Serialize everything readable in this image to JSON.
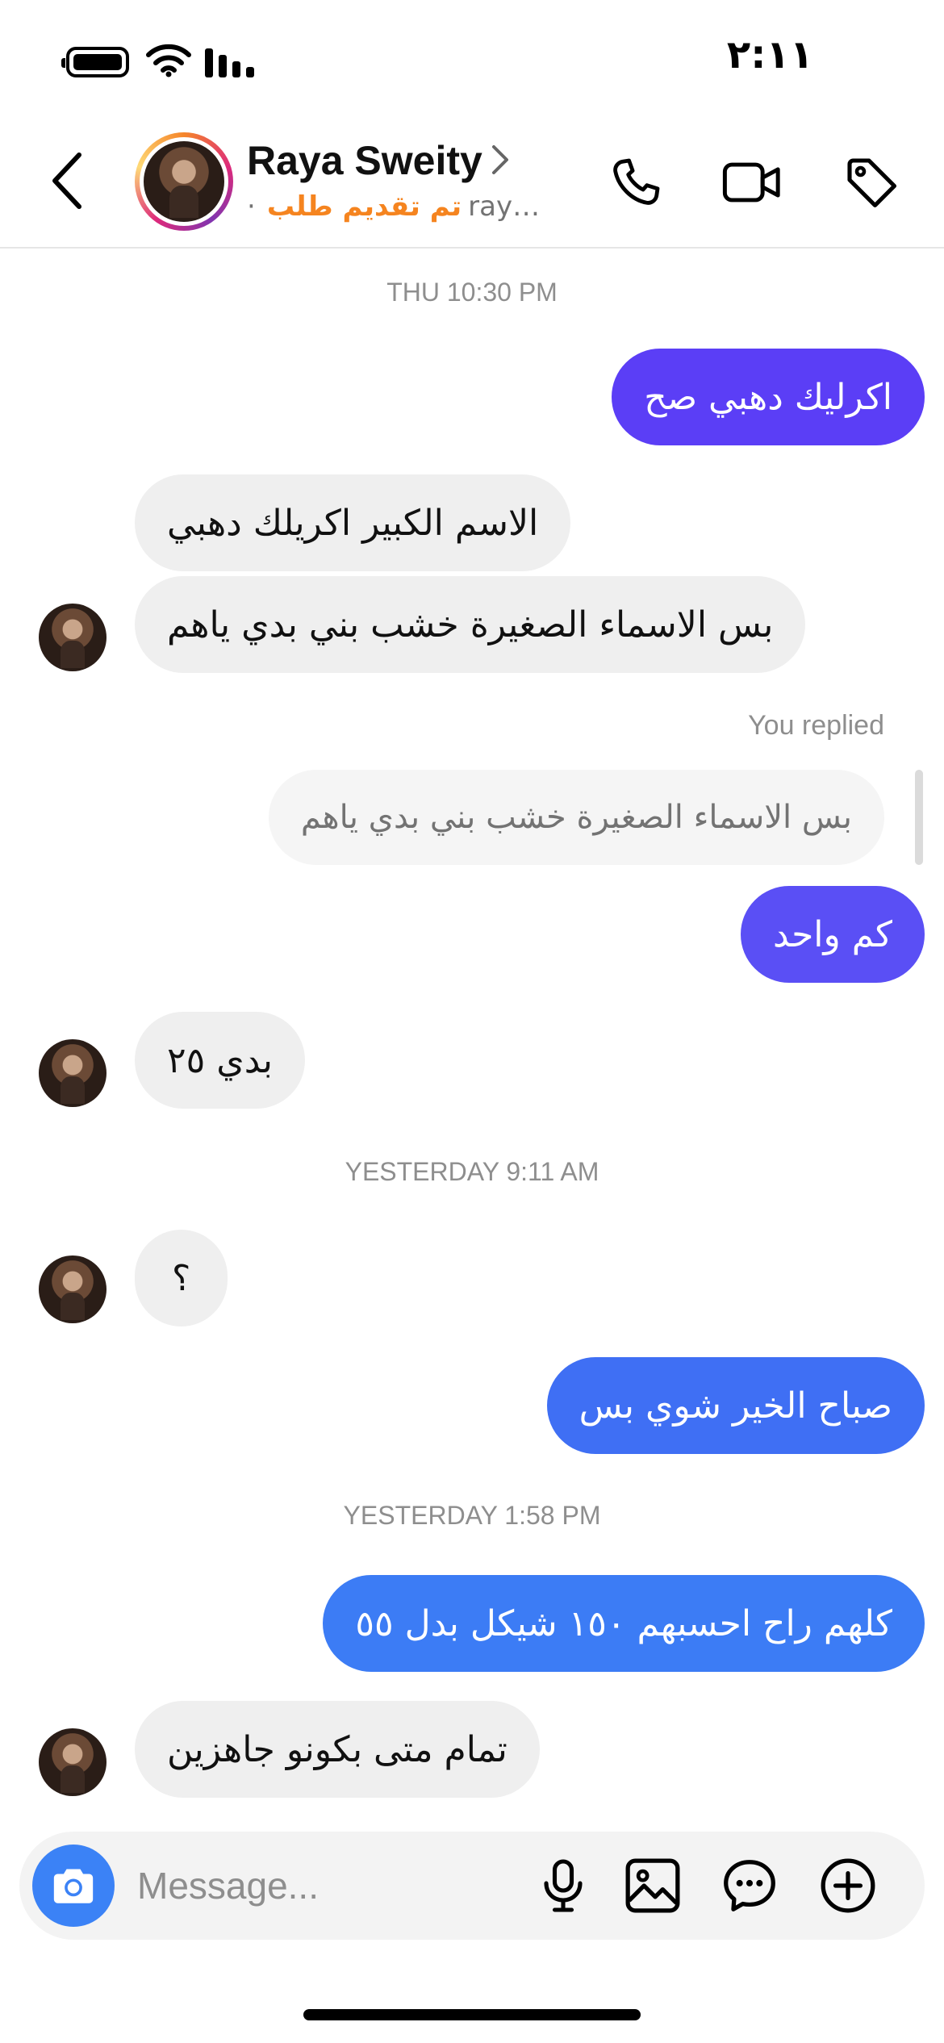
{
  "status_bar": {
    "time": "٢:١١"
  },
  "header": {
    "contact_name": "Raya Sweity",
    "username": "rayas...",
    "status_text": "تم تقديم طلب",
    "separator": "·"
  },
  "messages": [
    {
      "type": "timestamp",
      "text": "THU 10:30 PM"
    },
    {
      "type": "outgoing",
      "text": "اكرليك دهبي صح",
      "color": "#5b3ef6"
    },
    {
      "type": "incoming",
      "text": "الاسم الكبير اكريلك دهبي"
    },
    {
      "type": "incoming",
      "text": "بس الاسماء الصغيرة خشب بني بدي ياهم"
    },
    {
      "type": "reply_label",
      "text": "You replied"
    },
    {
      "type": "quoted",
      "text": "بس الاسماء الصغيرة خشب بني بدي ياهم"
    },
    {
      "type": "outgoing",
      "text": "كم واحد",
      "color": "#5a4ff5"
    },
    {
      "type": "incoming",
      "text": "بدي ٢٥"
    },
    {
      "type": "timestamp",
      "text": "YESTERDAY 9:11 AM"
    },
    {
      "type": "incoming",
      "text": "؟"
    },
    {
      "type": "outgoing",
      "text": "صباح الخير شوي بس",
      "color": "#3f6ff4"
    },
    {
      "type": "timestamp",
      "text": "YESTERDAY 1:58 PM"
    },
    {
      "type": "outgoing",
      "text": "كلهم راح احسبهم ١٥٠ شيكل بدل ٥٥",
      "color": "#3c7cf5"
    },
    {
      "type": "incoming",
      "text": "تمام متى بكونو جاهزين"
    }
  ],
  "composer": {
    "placeholder": "Message..."
  },
  "colors": {
    "accent_orange": "#f5841f",
    "camera_blue": "#3b82f6"
  },
  "icons": [
    "back-chevron-icon",
    "phone-icon",
    "video-icon",
    "tag-icon",
    "camera-icon",
    "microphone-icon",
    "image-icon",
    "sticker-icon",
    "plus-circle-icon"
  ]
}
